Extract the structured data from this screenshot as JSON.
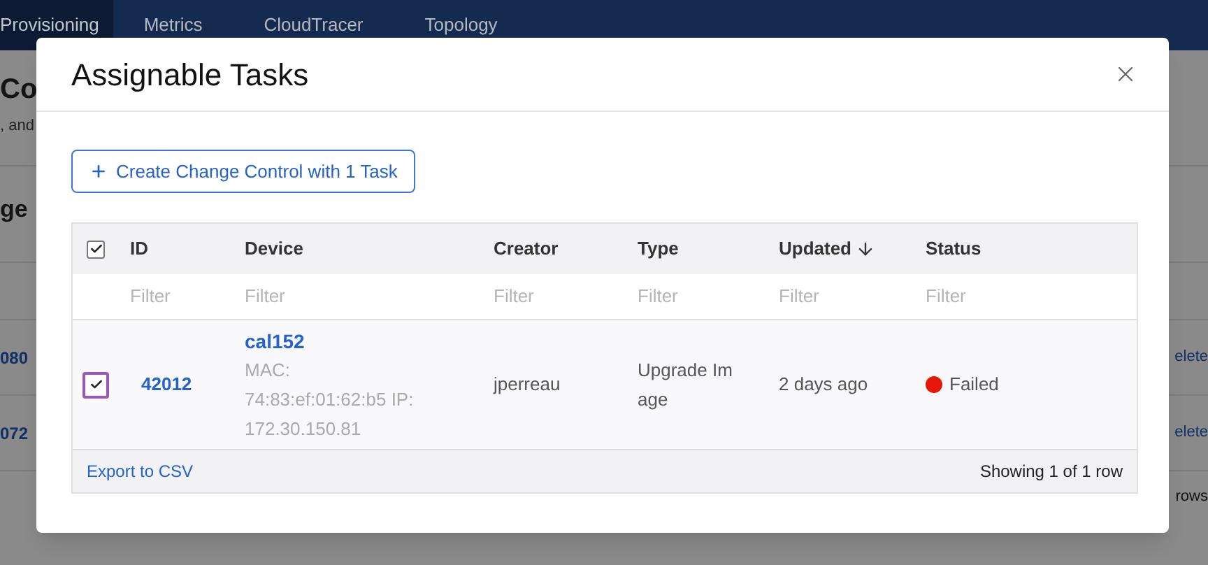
{
  "nav": {
    "tabs": [
      {
        "label": "Provisioning",
        "selected": true
      },
      {
        "label": "Metrics",
        "selected": false
      },
      {
        "label": "CloudTracer",
        "selected": false
      },
      {
        "label": "Topology",
        "selected": false
      }
    ]
  },
  "background": {
    "heading": "Co",
    "subtitle": ", and",
    "section": "ge",
    "rows": [
      {
        "id": "080",
        "action": "elete"
      },
      {
        "id": "072",
        "action": "elete"
      }
    ],
    "footer": "rows"
  },
  "modal": {
    "title": "Assignable Tasks",
    "create_button": "Create Change Control with 1 Task",
    "table": {
      "select_all": {
        "checked": true
      },
      "columns": [
        {
          "label": "ID",
          "sorted_descending": false,
          "filter_placeholder": "Filter"
        },
        {
          "label": "Device",
          "sorted_descending": false,
          "filter_placeholder": "Filter"
        },
        {
          "label": "Creator",
          "sorted_descending": false,
          "filter_placeholder": "Filter"
        },
        {
          "label": "Type",
          "sorted_descending": false,
          "filter_placeholder": "Filter"
        },
        {
          "label": "Updated",
          "sorted_descending": true,
          "filter_placeholder": "Filter"
        },
        {
          "label": "Status",
          "sorted_descending": false,
          "filter_placeholder": "Filter"
        }
      ],
      "rows": [
        {
          "checked": true,
          "focused": true,
          "id": "42012",
          "device": "cal152",
          "device_detail": "MAC: 74:83:ef:01:62:b5 IP: 172.30.150.81",
          "creator": "jperreau",
          "type": "Upgrade Image",
          "updated": "2 days ago",
          "status": {
            "label": "Failed",
            "color": "#e8170b"
          }
        }
      ],
      "export_link": "Export to CSV",
      "row_count": "Showing 1 of 1 row"
    }
  }
}
